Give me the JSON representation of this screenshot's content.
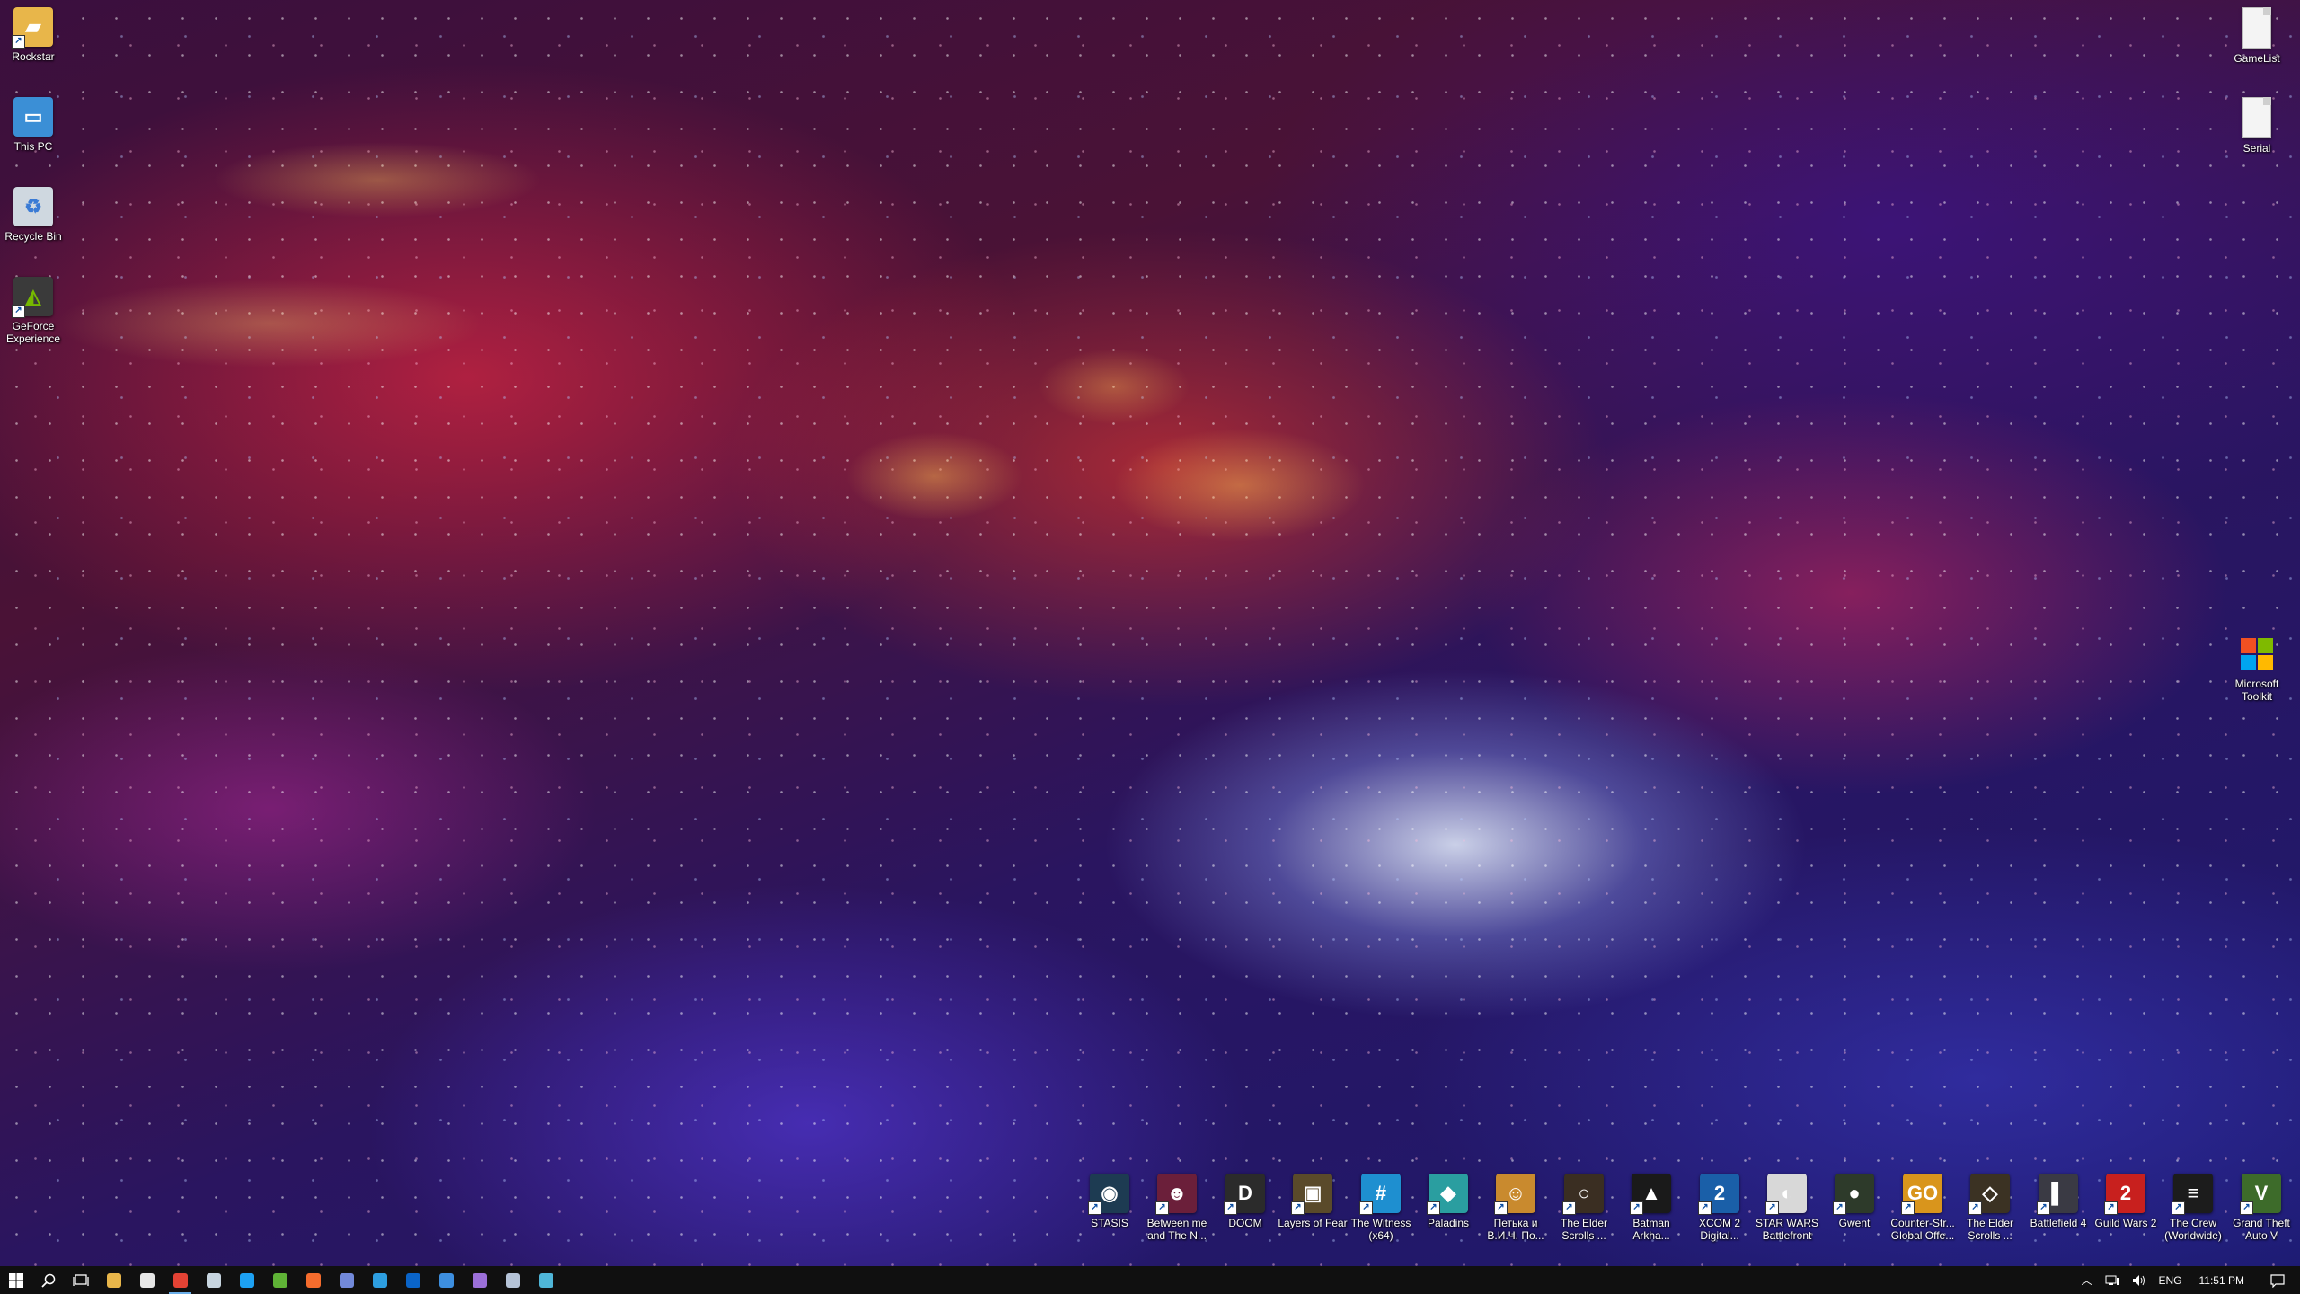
{
  "desktop": {
    "left_icons": [
      {
        "label": "Rockstar",
        "icon": "folder-person-icon",
        "color": "#e8b64a"
      },
      {
        "label": "This PC",
        "icon": "computer-icon",
        "color": "#3b8fd6"
      },
      {
        "label": "Recycle Bin",
        "icon": "recycle-bin-icon",
        "color": "#cfd8e0"
      },
      {
        "label": "GeForce Experience",
        "icon": "nvidia-icon",
        "color": "#3a3a3a"
      }
    ],
    "right_icons": [
      {
        "label": "GameList",
        "icon": "text-document-icon"
      },
      {
        "label": "Serial",
        "icon": "text-document-icon"
      },
      {
        "label": "Microsoft Toolkit",
        "icon": "windows-logo-icon"
      }
    ],
    "game_icons": [
      {
        "label": "STASIS",
        "icon": "stasis-icon",
        "color": "#1d3b52",
        "glyph": "◉"
      },
      {
        "label": "Between me and The N...",
        "icon": "between-me-icon",
        "color": "#6b1f3a",
        "glyph": "☻"
      },
      {
        "label": "DOOM",
        "icon": "doom-icon",
        "color": "#2b2b2b",
        "glyph": "D"
      },
      {
        "label": "Layers of Fear",
        "icon": "layers-of-fear-icon",
        "color": "#5a4a2a",
        "glyph": "▣"
      },
      {
        "label": "The Witness (x64)",
        "icon": "the-witness-icon",
        "color": "#1e8fd0",
        "glyph": "#"
      },
      {
        "label": "Paladins",
        "icon": "paladins-icon",
        "color": "#2a9ea0",
        "glyph": "◆"
      },
      {
        "label": "Петька и В.И.Ч. По...",
        "icon": "petka-icon",
        "color": "#c98a2e",
        "glyph": "☺"
      },
      {
        "label": "The Elder Scrolls ...",
        "icon": "elder-scrolls-ring-icon",
        "color": "#3a2e22",
        "glyph": "○"
      },
      {
        "label": "Batman Arkha...",
        "icon": "batman-icon",
        "color": "#1a1a1a",
        "glyph": "▲"
      },
      {
        "label": "XCOM 2 Digital...",
        "icon": "xcom2-icon",
        "color": "#1a5fa8",
        "glyph": "2"
      },
      {
        "label": "STAR WARS Battlefront",
        "icon": "star-wars-icon",
        "color": "#d8d8d8",
        "glyph": "◐"
      },
      {
        "label": "Gwent",
        "icon": "gwent-icon",
        "color": "#2d3a2a",
        "glyph": "●"
      },
      {
        "label": "Counter-Str... Global Offe...",
        "icon": "csgo-icon",
        "color": "#d9951c",
        "glyph": "GO"
      },
      {
        "label": "The Elder Scrolls ...",
        "icon": "elder-scrolls-icon",
        "color": "#3b3223",
        "glyph": "◇"
      },
      {
        "label": "Battlefield 4",
        "icon": "battlefield4-icon",
        "color": "#3a3a44",
        "glyph": "▌"
      },
      {
        "label": "Guild Wars 2",
        "icon": "guild-wars-2-icon",
        "color": "#c8201e",
        "glyph": "2"
      },
      {
        "label": "The Crew (Worldwide)",
        "icon": "the-crew-icon",
        "color": "#1c1c1c",
        "glyph": "≡"
      },
      {
        "label": "Grand Theft Auto V",
        "icon": "gta-v-icon",
        "color": "#3d6b2a",
        "glyph": "V"
      }
    ]
  },
  "taskbar": {
    "start": {
      "icon": "windows-start-icon"
    },
    "search": {
      "icon": "search-icon"
    },
    "task_view": {
      "icon": "task-view-icon"
    },
    "apps": [
      {
        "name": "file-explorer",
        "icon": "folder-icon",
        "color": "#e8b64a"
      },
      {
        "name": "store",
        "icon": "store-icon",
        "color": "#e6e6e6"
      },
      {
        "name": "chrome",
        "icon": "chrome-icon",
        "color": "#e34234",
        "active": true
      },
      {
        "name": "steam",
        "icon": "steam-icon",
        "color": "#c7d5e0"
      },
      {
        "name": "skype",
        "icon": "skype-icon",
        "color": "#1da1f2"
      },
      {
        "name": "utorrent",
        "icon": "utorrent-icon",
        "color": "#5fb336"
      },
      {
        "name": "origin",
        "icon": "origin-icon",
        "color": "#f56c2d"
      },
      {
        "name": "discord",
        "icon": "discord-icon",
        "color": "#7289da"
      },
      {
        "name": "uplay",
        "icon": "uplay-icon",
        "color": "#2d9ee0"
      },
      {
        "name": "outlook",
        "icon": "outlook-icon",
        "color": "#0a64c8"
      },
      {
        "name": "photos",
        "icon": "photos-icon",
        "color": "#3d8fe0"
      },
      {
        "name": "groove",
        "icon": "groove-icon",
        "color": "#9b6fd8"
      },
      {
        "name": "keyboard",
        "icon": "keyboard-icon",
        "color": "#b6c4d8"
      },
      {
        "name": "app-13",
        "icon": "app-icon",
        "color": "#4fb6d8"
      }
    ],
    "tray": {
      "overflow_icon": "chevron-up-icon",
      "network_icon": "network-icon",
      "volume_icon": "volume-icon",
      "language": "ENG",
      "time": "11:51 PM",
      "notification_icon": "action-center-icon"
    }
  },
  "colors": {
    "taskbar_bg": "#101010",
    "active_indicator": "#6aaee8"
  }
}
